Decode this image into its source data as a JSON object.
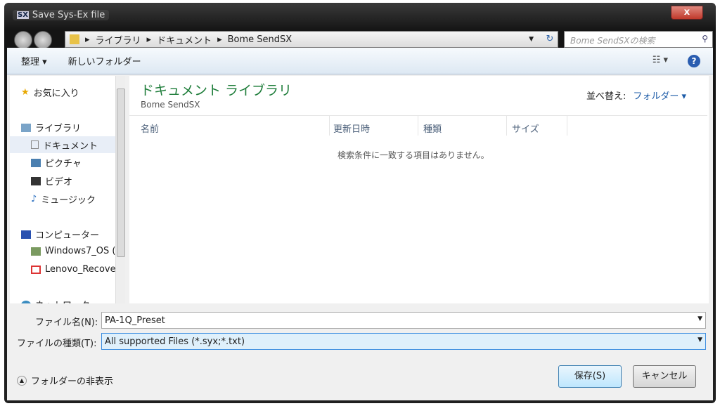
{
  "window": {
    "title": "Save Sys-Ex file",
    "icon_text": "SX",
    "close": "x"
  },
  "address": {
    "crumbs": [
      "ライブラリ",
      "ドキュメント",
      "Bome SendSX"
    ],
    "search_placeholder": "Bome SendSXの検索"
  },
  "toolbar": {
    "organize": "整理 ▾",
    "new_folder": "新しいフォルダー"
  },
  "sidebar": {
    "items": [
      {
        "label": "お気に入り",
        "icon": "star-icon"
      },
      {
        "label": "ライブラリ",
        "icon": "library-icon"
      },
      {
        "label": "ドキュメント",
        "icon": "document-icon",
        "selected": true
      },
      {
        "label": "ピクチャ",
        "icon": "picture-icon"
      },
      {
        "label": "ビデオ",
        "icon": "video-icon"
      },
      {
        "label": "ミュージック",
        "icon": "music-icon"
      },
      {
        "label": "コンピューター",
        "icon": "computer-icon"
      },
      {
        "label": "Windows7_OS (",
        "icon": "drive-icon"
      },
      {
        "label": "Lenovo_Recove",
        "icon": "recovery-drive-icon"
      },
      {
        "label": "ネットワーク",
        "icon": "network-icon"
      }
    ]
  },
  "main": {
    "library_title": "ドキュメント ライブラリ",
    "library_subtitle": "Bome SendSX",
    "sort_label": "並べ替え:",
    "sort_value": "フォルダー ▾",
    "columns": [
      "名前",
      "更新日時",
      "種類",
      "サイズ"
    ],
    "empty_message": "検索条件に一致する項目はありません。"
  },
  "form": {
    "filename_label": "ファイル名(N):",
    "filename_value": "PA-1Q_Preset",
    "filetype_label": "ファイルの種類(T):",
    "filetype_value": "All supported Files (*.syx;*.txt)"
  },
  "buttons": {
    "save": "保存(S)",
    "cancel": "キャンセル",
    "hide_folders": "フォルダーの非表示"
  }
}
